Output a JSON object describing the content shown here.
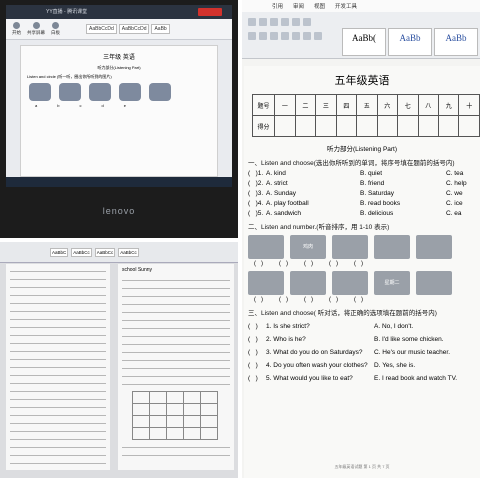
{
  "panel_laptop": {
    "app_title": "YY直播 - 腾讯课堂",
    "doc_title": "三年级 英语",
    "toolbar": {
      "items": [
        "开始",
        "共享屏幕",
        "白板"
      ]
    },
    "styles": [
      "AaBbCcDd",
      "AaBbCcDd",
      "AaBb"
    ],
    "part_title": "听力部分(Listening Part)",
    "question": "Listen and circle (听一听，圈出你所听到的图片)",
    "letters": [
      "a",
      "b",
      "c",
      "d",
      "e"
    ],
    "brand": "lenovo"
  },
  "panel_word": {
    "menu": [
      "引用",
      "审阅",
      "视图",
      "开发工具"
    ],
    "styles": [
      {
        "label": "AaBb("
      },
      {
        "label": "AaBb"
      },
      {
        "label": "AaBb"
      }
    ],
    "title": "五年级英语",
    "score_table": {
      "row1_label": "题号",
      "row2_label": "得分",
      "cols": [
        "一",
        "二",
        "三",
        "四",
        "五",
        "六",
        "七",
        "八",
        "九",
        "十"
      ]
    },
    "part": "听力部分(Listening Part)",
    "section1": "一、Listen and choose(选出你所听到的单词，将序号填在题前的括号内)",
    "section1_items": [
      {
        "n": "1",
        "a": "A. kind",
        "b": "B. quiet",
        "c": "C. tea"
      },
      {
        "n": "2",
        "a": "A. strict",
        "b": "B. friend",
        "c": "C. help"
      },
      {
        "n": "3",
        "a": "A. Sunday",
        "b": "B. Saturday",
        "c": "C. we"
      },
      {
        "n": "4",
        "a": "A. play football",
        "b": "B. read books",
        "c": "C. ice"
      },
      {
        "n": "5",
        "a": "A. sandwich",
        "b": "B. delicious",
        "c": "C. ea"
      }
    ],
    "section2": "二、Listen and number.(听音排序，用 1-10 表示)",
    "section2_labels": [
      "鸡肉",
      "星期二"
    ],
    "section3": "三、Listen and choose( 听对话，将正确的选项填在题前的括号内)",
    "section3_items": [
      {
        "n": "1",
        "q": "Is she strict?",
        "a": "A. No, I don't."
      },
      {
        "n": "2",
        "q": "Who is he?",
        "a": "B. I'd like some chicken."
      },
      {
        "n": "3",
        "q": "What do you do on Saturdays?",
        "a": "C. He's our music teacher."
      },
      {
        "n": "4",
        "q": "Do you often wash your clothes?",
        "a": "D. Yes, she is."
      },
      {
        "n": "5",
        "q": "What would you like to eat?",
        "a": "E. I read book and watch TV."
      }
    ],
    "footer": "五年级英语试题 第 1 页 共 7 页"
  },
  "panel_monitor": {
    "styles": [
      "AaBbC",
      "AaBbCc",
      "AaBbCc",
      "AaBbCc"
    ],
    "right_header": "school Sunny"
  }
}
